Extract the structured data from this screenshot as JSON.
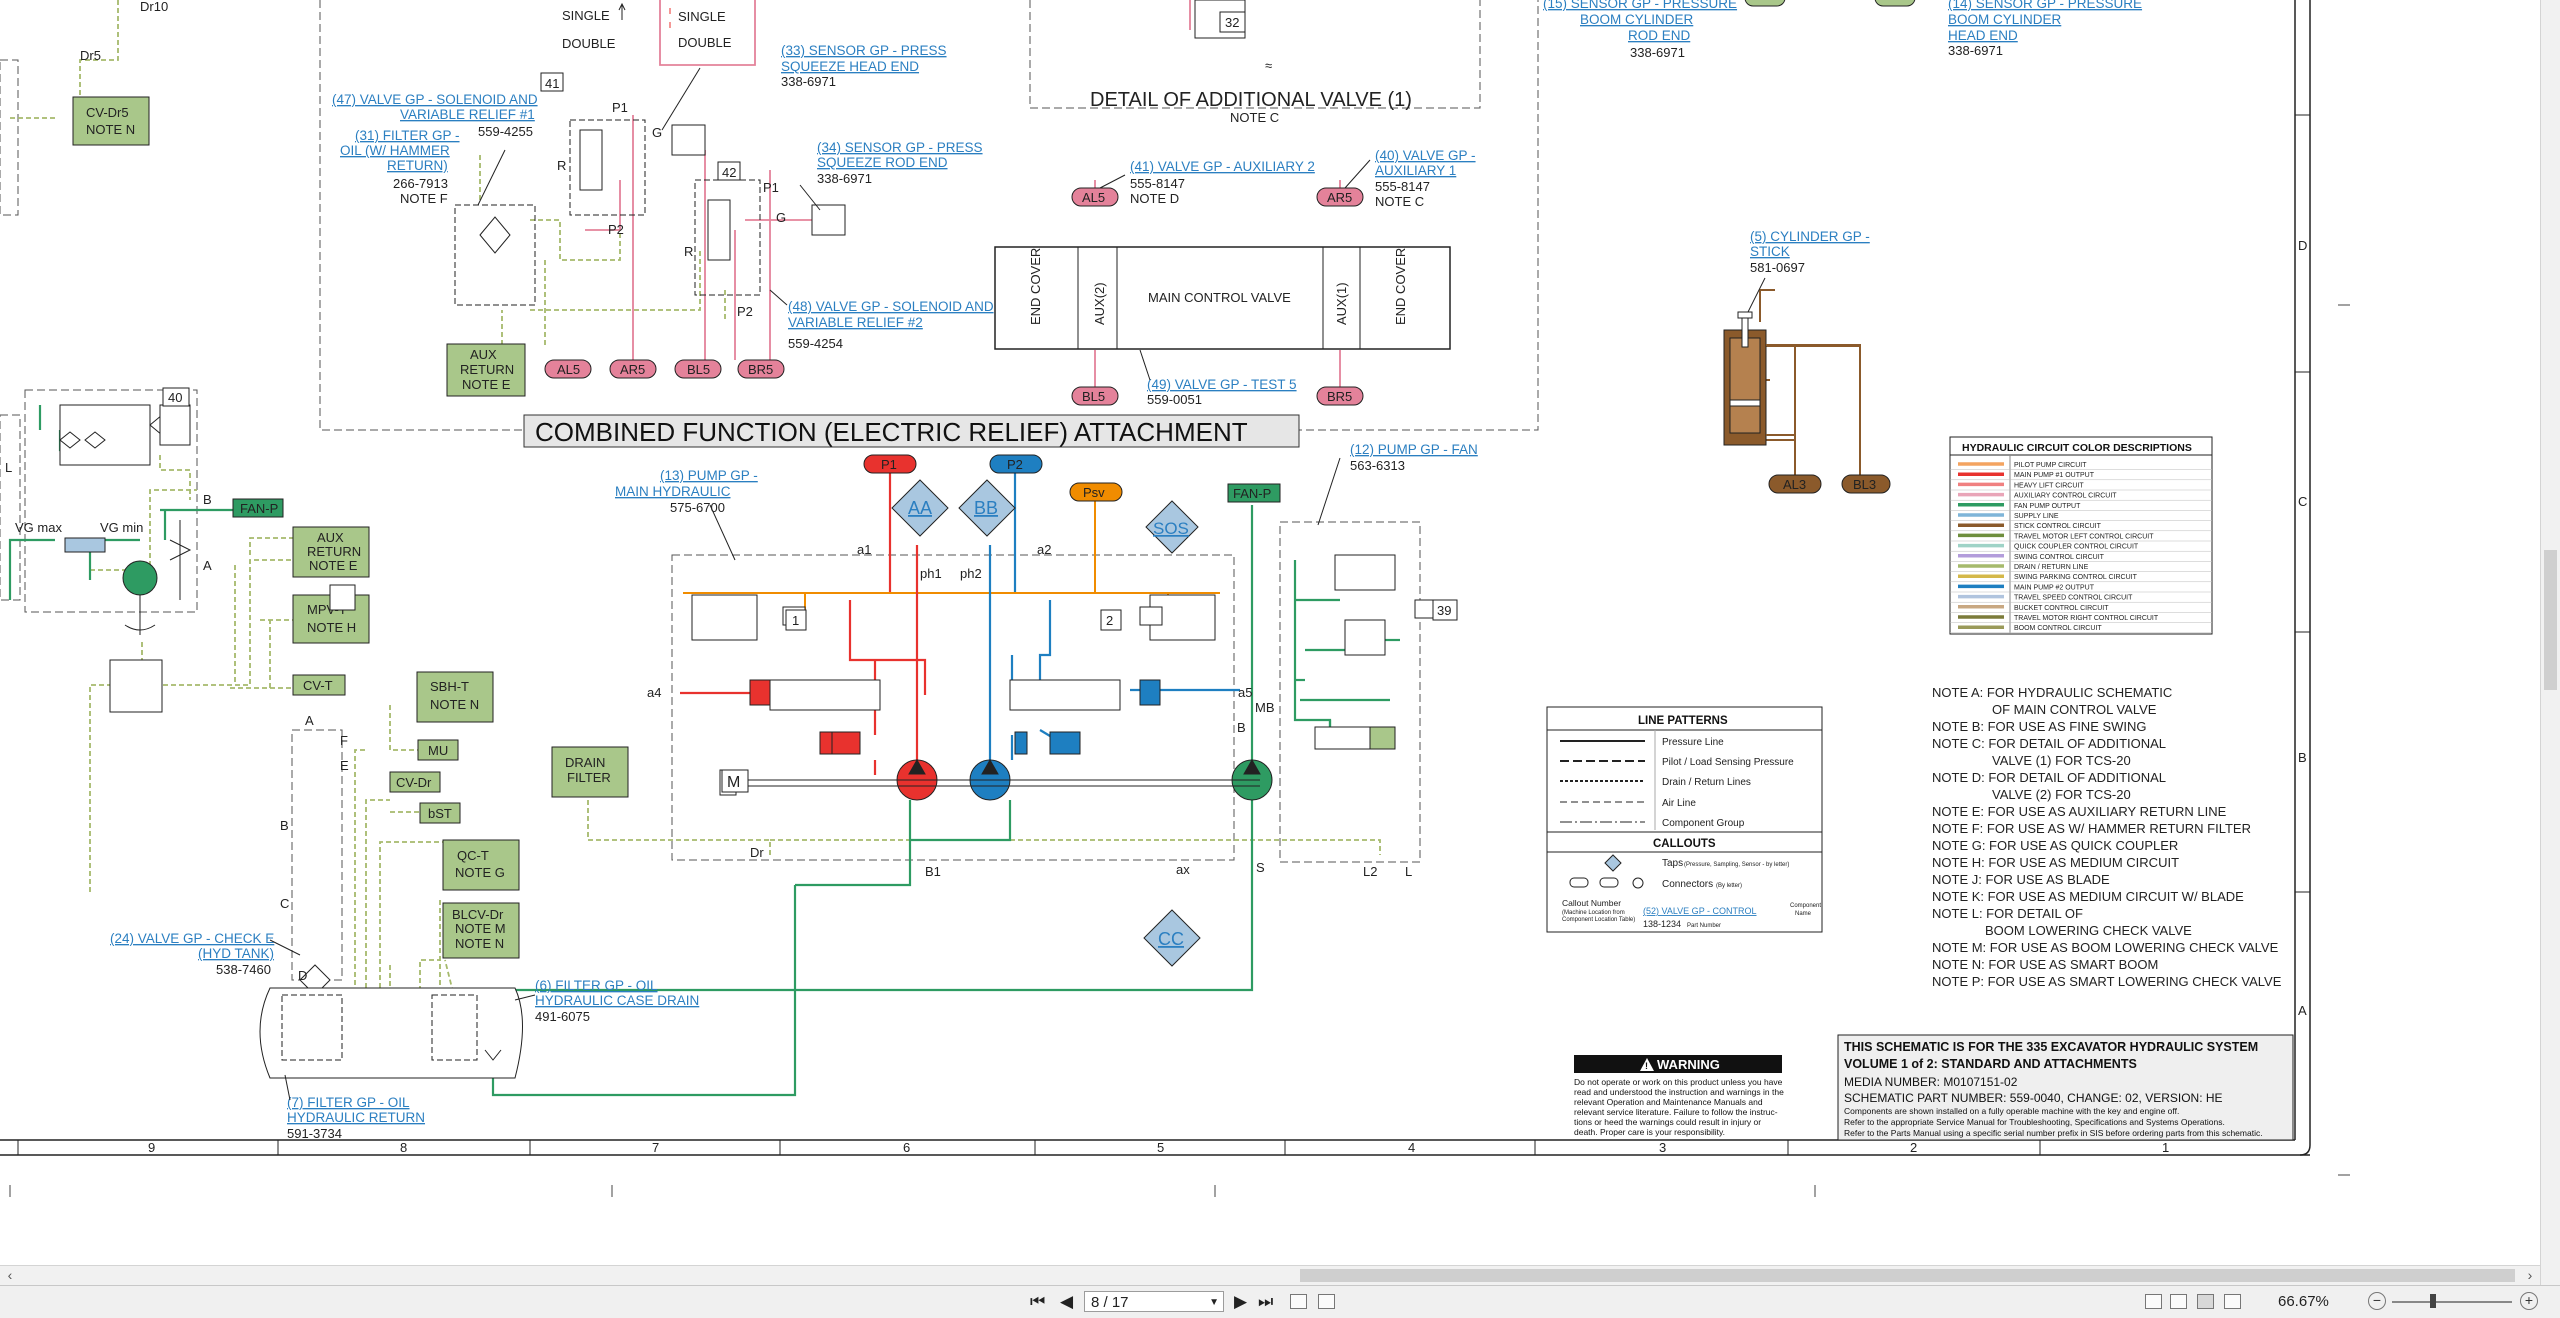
{
  "schematic": {
    "main_title": "COMBINED FUNCTION (ELECTRIC RELIEF) ATTACHMENT",
    "detail_title": "DETAIL OF ADDITIONAL VALVE (1)",
    "detail_note": "NOTE C",
    "single_label": "SINGLE",
    "double_label": "DOUBLE",
    "dr10": "Dr10",
    "dr5": "Dr5",
    "dr": "Dr",
    "box_cv_dr5": [
      "CV-Dr5",
      "NOTE N"
    ],
    "box_aux_return_e": [
      "AUX",
      "RETURN",
      "NOTE E"
    ],
    "box_aux_return_e2": [
      "AUX",
      "RETURN",
      "NOTE E"
    ],
    "box_mpv_t": [
      "MPV-T",
      "NOTE H"
    ],
    "box_cv_t": "CV-T",
    "box_sbh_t": [
      "SBH-T",
      "NOTE N"
    ],
    "box_mu": "MU",
    "box_cv_dr": "CV-Dr",
    "box_bst": "bST",
    "box_qc_t": [
      "QC-T",
      "NOTE G"
    ],
    "box_blcv": [
      "BLCV-Dr",
      "NOTE M",
      "NOTE N"
    ],
    "box_drain_filter": [
      "DRAIN",
      "FILTER"
    ],
    "box_fan_p": "FAN-P",
    "box_fan_p2": "FAN-P",
    "vg_max": "VG max",
    "vg_min": "VG min",
    "callouts": {
      "c47": {
        "link": [
          "(47) VALVE GP - SOLENOID AND",
          "VARIABLE RELIEF #1"
        ],
        "pn": "559-4255"
      },
      "c31": {
        "link": [
          "(31) FILTER GP -",
          "OIL (W/ HAMMER",
          "RETURN)"
        ],
        "pn": "266-7913",
        "note": "NOTE F"
      },
      "c33": {
        "link": [
          "(33) SENSOR GP - PRESS",
          "SQUEEZE HEAD END"
        ],
        "pn": "338-6971"
      },
      "c34": {
        "link": [
          "(34) SENSOR GP - PRESS",
          "SQUEEZE ROD END"
        ],
        "pn": "338-6971"
      },
      "c48": {
        "link": [
          "(48) VALVE GP - SOLENOID AND",
          "VARIABLE RELIEF #2"
        ],
        "pn": "559-4254"
      },
      "c41": {
        "link": [
          "(41) VALVE GP - AUXILIARY 2"
        ],
        "pn": "555-8147",
        "note": "NOTE D"
      },
      "c40": {
        "link": [
          "(40) VALVE GP -",
          "AUXILIARY 1"
        ],
        "pn": "555-8147",
        "note": "NOTE C"
      },
      "c49": {
        "link": [
          "(49) VALVE GP - TEST 5"
        ],
        "pn": "559-0051"
      },
      "c15": {
        "link": [
          "(15) SENSOR GP - PRESSURE",
          "BOOM CYLINDER",
          "ROD END"
        ],
        "pn": "338-6971"
      },
      "c14": {
        "link": [
          "(14) SENSOR GP - PRESSURE",
          "BOOM CYLINDER",
          "HEAD END"
        ],
        "pn": "338-6971"
      },
      "c5": {
        "link": [
          "(5) CYLINDER GP -",
          "STICK"
        ],
        "pn": "581-0697"
      },
      "c13": {
        "link": [
          "(13) PUMP GP -",
          "MAIN HYDRAULIC"
        ],
        "pn": "575-6700"
      },
      "c12": {
        "link": [
          "(12) PUMP GP - FAN"
        ],
        "pn": "563-6313"
      },
      "c24": {
        "link": [
          "(24) VALVE GP - CHECK E",
          "(HYD TANK)"
        ],
        "pn": "538-7460"
      },
      "c6": {
        "link": [
          "(6) FILTER GP - OIL",
          "HYDRAULIC CASE DRAIN"
        ],
        "pn": "491-6075"
      },
      "c7": {
        "link": [
          "(7) FILTER GP - OIL",
          "HYDRAULIC RETURN"
        ],
        "pn": "591-3734"
      }
    },
    "main_control_valve": {
      "label": "MAIN CONTROL VALVE",
      "end_cover": "END COVER",
      "aux2": "AUX(2)",
      "aux1": "AUX(1)"
    },
    "ports": {
      "al5": "AL5",
      "ar5": "AR5",
      "bl5": "BL5",
      "br5": "BR5",
      "p1": "P1",
      "p2": "P2",
      "psv": "Psv",
      "al3": "AL3",
      "bl3": "BL3"
    },
    "diamonds": {
      "aa": "AA",
      "bb": "BB",
      "sos": "SOS",
      "cc": "CC"
    },
    "numbers": {
      "n32": "32",
      "n41": "41",
      "n42": "42",
      "n40": "40",
      "n1": "1",
      "n2": "2",
      "n39": "39"
    },
    "small_labels": {
      "p1": "P1",
      "p2": "P2",
      "g": "G",
      "r": "R",
      "a1": "a1",
      "a2": "a2",
      "a4": "a4",
      "a5": "a5",
      "ax": "ax",
      "ph1": "ph1",
      "ph2": "ph2",
      "mb": "MB",
      "b": "B",
      "b1": "B1",
      "s": "S",
      "l": "L",
      "l2": "L2",
      "m": "M",
      "a": "A",
      "e": "E",
      "f": "F",
      "c": "C",
      "d": "D"
    },
    "color_table": {
      "title": "HYDRAULIC CIRCUIT COLOR DESCRIPTIONS",
      "rows": [
        {
          "label": "PILOT PUMP CIRCUIT",
          "color": "#f4a460"
        },
        {
          "label": "MAIN PUMP #1 OUTPUT",
          "color": "#e8322e"
        },
        {
          "label": "HEAVY LIFT CIRCUIT",
          "color": "#f08080"
        },
        {
          "label": "AUXILIARY CONTROL CIRCUIT",
          "color": "#e9a5b8"
        },
        {
          "label": "FAN PUMP OUTPUT",
          "color": "#2e9b62"
        },
        {
          "label": "SUPPLY LINE",
          "color": "#7fb5d9"
        },
        {
          "label": "STICK CONTROL CIRCUIT",
          "color": "#8b5a2b"
        },
        {
          "label": "TRAVEL MOTOR LEFT CONTROL CIRCUIT",
          "color": "#6f8f3e"
        },
        {
          "label": "QUICK COUPLER CONTROL CIRCUIT",
          "color": "#9fd3c7"
        },
        {
          "label": "SWING CONTROL CIRCUIT",
          "color": "#b39ddb"
        },
        {
          "label": "DRAIN / RETURN LINE",
          "color": "#a6ba6c"
        },
        {
          "label": "SWING PARKING CONTROL CIRCUIT",
          "color": "#d4b84a"
        },
        {
          "label": "MAIN PUMP #2 OUTPUT",
          "color": "#1e7fc1"
        },
        {
          "label": "TRAVEL SPEED CONTROL CIRCUIT",
          "color": "#b0c4de"
        },
        {
          "label": "BUCKET CONTROL CIRCUIT",
          "color": "#c8a882"
        },
        {
          "label": "TRAVEL MOTOR RIGHT CONTROL CIRCUIT",
          "color": "#7b7b3a"
        },
        {
          "label": "BOOM CONTROL CIRCUIT",
          "color": "#9a9a5a"
        }
      ]
    },
    "line_patterns": {
      "title": "LINE PATTERNS",
      "rows": [
        "Pressure Line",
        "Pilot / Load Sensing Pressure",
        "Drain / Return Lines",
        "Air Line",
        "Component Group"
      ],
      "callouts_title": "CALLOUTS",
      "taps": "Taps",
      "taps_sub": "(Pressure, Sampling, Sensor - by letter)",
      "connectors": "Connectors",
      "connectors_sub": "(By letter)",
      "callout_number": "Callout Number",
      "callout_number_sub": [
        "(Machine Location from",
        "Component Location Table)"
      ],
      "callout_example": "(52) VALVE GP - CONTROL",
      "callout_example_pn": "138-1234",
      "part_number_label": "Part Number",
      "component_name_label": [
        "Component",
        "Name"
      ]
    },
    "notes": [
      "NOTE A: FOR HYDRAULIC SCHEMATIC",
      "OF MAIN CONTROL VALVE",
      "NOTE B: FOR USE AS FINE SWING",
      "NOTE C: FOR DETAIL OF ADDITIONAL",
      "VALVE (1) FOR TCS-20",
      "NOTE D: FOR DETAIL OF ADDITIONAL",
      "VALVE (2) FOR TCS-20",
      "NOTE E: FOR USE AS AUXILIARY RETURN LINE",
      "NOTE F: FOR USE AS W/ HAMMER RETURN FILTER",
      "NOTE G: FOR USE AS QUICK COUPLER",
      "NOTE H: FOR USE AS MEDIUM CIRCUIT",
      "NOTE J: FOR USE AS BLADE",
      "NOTE K: FOR USE AS MEDIUM CIRCUIT W/ BLADE",
      "NOTE L: FOR DETAIL OF",
      "BOOM LOWERING CHECK VALVE",
      "NOTE M: FOR USE AS BOOM LOWERING CHECK VALVE",
      "NOTE N: FOR USE AS SMART BOOM",
      "NOTE P: FOR USE AS SMART LOWERING CHECK VALVE"
    ],
    "warning": {
      "title": "WARNING",
      "body": [
        "Do not operate or work on this product unless you have",
        "read and understood the instruction and warnings in the",
        "relevant Operation and Maintenance Manuals and",
        "relevant service literature. Failure to follow the instruc-",
        "tions or heed the warnings could result in injury or",
        "death. Proper care is your responsibility."
      ]
    },
    "title_block": [
      "THIS SCHEMATIC IS FOR THE 335 EXCAVATOR HYDRAULIC SYSTEM",
      "VOLUME 1 of 2: STANDARD AND ATTACHMENTS",
      "MEDIA NUMBER: M0107151-02",
      "SCHEMATIC PART NUMBER: 559-0040, CHANGE: 02, VERSION: HE",
      "Components are shown installed on a fully operable machine with the key and engine off.",
      "Refer to the appropriate Service Manual for Troubleshooting, Specifications and Systems Operations.",
      "Refer to the Parts Manual using a specific serial number prefix in SIS before ordering parts from this schematic."
    ],
    "grid_columns": [
      "9",
      "8",
      "7",
      "6",
      "5",
      "4",
      "3",
      "2",
      "1"
    ],
    "grid_rows": [
      "D",
      "C",
      "B",
      "A"
    ]
  },
  "toolbar": {
    "page_value": "8 / 17",
    "zoom_value": "66.67%"
  },
  "colors": {
    "pink": "#e4829a",
    "red": "#e8322e",
    "blue": "#1e7fc1",
    "green": "#2e9b62",
    "orange": "#f08c00",
    "brown": "#8b5a2b",
    "drain": "#a6ba6c",
    "box_green": "#a9c78a",
    "link": "#2b7fc1"
  }
}
